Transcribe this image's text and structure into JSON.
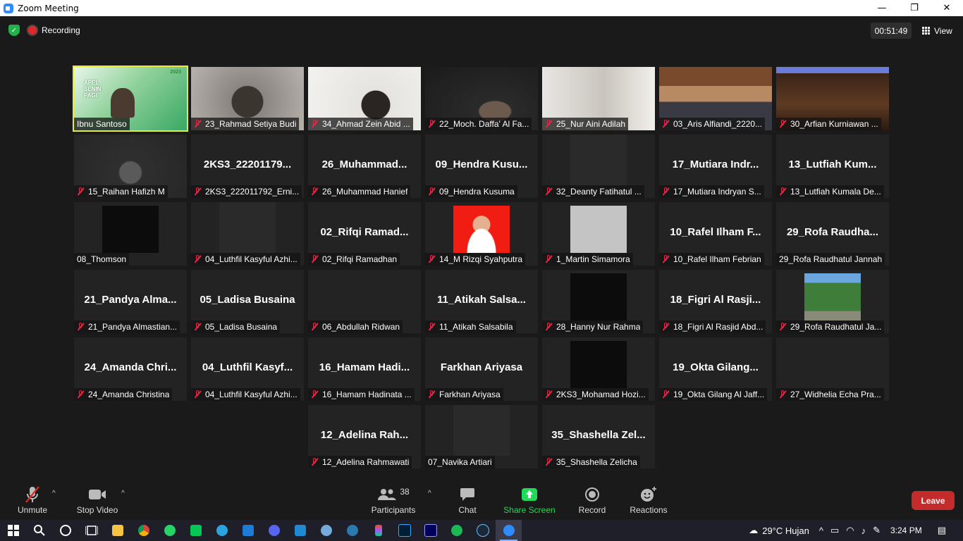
{
  "window": {
    "title": "Zoom Meeting",
    "minimize": "—",
    "maximize": "❐",
    "close": "✕"
  },
  "topbar": {
    "recording_label": "Recording",
    "timer": "00:51:49",
    "view_label": "View"
  },
  "tiles": [
    {
      "label": "Ibnu Santoso",
      "big": "",
      "muted": false,
      "active": true,
      "video": "apel"
    },
    {
      "label": "23_Rahmad Setiya Budi",
      "big": "",
      "muted": true,
      "video": "cam-gray"
    },
    {
      "label": "34_Ahmad Zein Abid ...",
      "big": "",
      "muted": true,
      "video": "cam-white"
    },
    {
      "label": "22_Moch. Daffa' Al Fa...",
      "big": "",
      "muted": true,
      "video": "cam-dark"
    },
    {
      "label": "25_Nur Aini Adilah",
      "big": "",
      "muted": true,
      "video": "cam-room"
    },
    {
      "label": "03_Aris Alfiandi_2220...",
      "big": "",
      "muted": true,
      "video": "cam-wood"
    },
    {
      "label": "30_Arfian Kurniawan ...",
      "big": "",
      "muted": true,
      "video": "cam-living"
    },
    {
      "label": "15_Raihan Hafizh M",
      "big": "",
      "muted": true,
      "video": "cam-dim"
    },
    {
      "label": "2KS3_222011792_Erni...",
      "big": "2KS3_22201179...",
      "muted": true
    },
    {
      "label": "26_Muhammad Hanief",
      "big": "26_Muhammad...",
      "muted": true
    },
    {
      "label": "09_Hendra Kusuma",
      "big": "09_Hendra  Kusu...",
      "muted": true
    },
    {
      "label": "32_Deanty Fatihatul ...",
      "big": "",
      "muted": true,
      "video": "block-dark"
    },
    {
      "label": "17_Mutiara Indryan S...",
      "big": "17_Mutiara  Indr...",
      "muted": true
    },
    {
      "label": "13_Lutfiah Kumala De...",
      "big": "13_Lutfiah  Kum...",
      "muted": true
    },
    {
      "label": "08_Thomson",
      "big": "",
      "muted": false,
      "video": "block-black"
    },
    {
      "label": "04_Luthfil Kasyful Azhi...",
      "big": "",
      "muted": true,
      "video": "block-dark"
    },
    {
      "label": "02_Rifqi Ramadhan",
      "big": "02_Rifqi  Ramad...",
      "muted": true
    },
    {
      "label": "14_M Rizqi Syahputra",
      "big": "",
      "muted": true,
      "video": "red-photo"
    },
    {
      "label": "1_Martin Simamora",
      "big": "",
      "muted": true,
      "video": "block-gray"
    },
    {
      "label": "10_Rafel Ilham Febrian",
      "big": "10_Rafel  Ilham  F...",
      "muted": true
    },
    {
      "label": "29_Rofa Raudhatul Jannah",
      "big": "29_Rofa  Raudha...",
      "muted": false
    },
    {
      "label": "21_Pandya Almastian...",
      "big": "21_Pandya  Alma...",
      "muted": true
    },
    {
      "label": "05_Ladisa Busaina",
      "big": "05_Ladisa Busaina",
      "muted": true
    },
    {
      "label": "06_Abdullah Ridwan",
      "big": "",
      "muted": true
    },
    {
      "label": "11_Atikah Salsabila",
      "big": "11_Atikah  Salsa...",
      "muted": true
    },
    {
      "label": "28_Hanny Nur Rahma",
      "big": "",
      "muted": true,
      "video": "block-black"
    },
    {
      "label": "18_Figri Al Rasjid Abd...",
      "big": "18_Figri  Al  Rasji...",
      "muted": true
    },
    {
      "label": "29_Rofa Raudhatul Ja...",
      "big": "",
      "muted": true,
      "video": "trees"
    },
    {
      "label": "24_Amanda Christina",
      "big": "24_Amanda  Chri...",
      "muted": true
    },
    {
      "label": "04_Luthfil Kasyful Azhi...",
      "big": "04_Luthfil  Kasyf...",
      "muted": true
    },
    {
      "label": "16_Hamam Hadinata ...",
      "big": "16_Hamam  Hadi...",
      "muted": true
    },
    {
      "label": "Farkhan Ariyasa",
      "big": "Farkhan Ariyasa",
      "muted": true
    },
    {
      "label": "2KS3_Mohamad Hozi...",
      "big": "",
      "muted": true,
      "video": "block-black"
    },
    {
      "label": "19_Okta Gilang Al Jaff...",
      "big": "19_Okta  Gilang...",
      "muted": true
    },
    {
      "label": "27_Widhelia Echa Pra...",
      "big": "",
      "muted": true
    },
    {
      "label": "12_Adelina Rahmawati",
      "big": "12_Adelina  Rah...",
      "muted": true
    },
    {
      "label": "07_Navika Artiari",
      "big": "",
      "muted": false,
      "video": "block-dark"
    },
    {
      "label": "35_Shashella Zelicha",
      "big": "35_Shashella  Zel...",
      "muted": true
    }
  ],
  "apel_card": {
    "line1": "APEL",
    "line2": "SENIN",
    "line3": "PAGI",
    "year": "2023"
  },
  "toolbar": {
    "unmute": "Unmute",
    "stop_video": "Stop Video",
    "participants": "Participants",
    "participants_count": "38",
    "chat": "Chat",
    "share": "Share Screen",
    "record": "Record",
    "reactions": "Reactions",
    "leave": "Leave"
  },
  "taskbar": {
    "weather": "29°C  Hujan",
    "time": "3:24 PM"
  },
  "colors": {
    "share_green": "#23d959",
    "leave_red": "#c52b2b",
    "active_border": "#e9e93a",
    "muted_red": "#ee2244"
  }
}
